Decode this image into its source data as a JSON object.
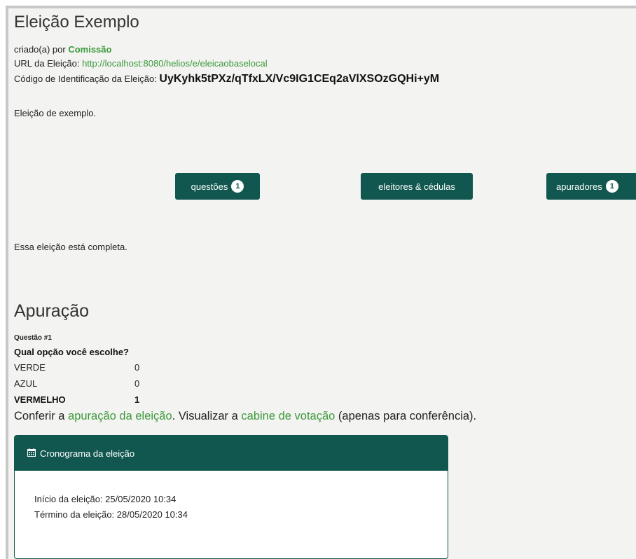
{
  "election": {
    "title": "Eleição Exemplo",
    "created_by_prefix": "criado(a) por ",
    "creator": "Comissão",
    "url_label": "URL da Eleição: ",
    "url": "http://localhost:8080/helios/e/eleicaobaselocal",
    "code_label": "Código de Identificação da Eleição: ",
    "code": "UyKyhk5tPXz/qTfxLX/Vc9IG1CEq2aVlXSOzGQHi+yM",
    "description": "Eleição de exemplo."
  },
  "nav": {
    "questions": {
      "label": "questões",
      "count": "1"
    },
    "voters": {
      "label": "eleitores & cédulas"
    },
    "trustees": {
      "label": "apuradores",
      "count": "1"
    }
  },
  "status": "Essa eleição está completa.",
  "results": {
    "heading": "Apuração",
    "question_number": "Questão #1",
    "question_text": "Qual opção você escolhe?",
    "answers": [
      {
        "label": "VERDE",
        "count": "0"
      },
      {
        "label": "AZUL",
        "count": "0"
      },
      {
        "label": "VERMELHO",
        "count": "1"
      }
    ]
  },
  "verify": {
    "text1": "Conferir a ",
    "link1": "apuração da eleição",
    "text2": ". Visualizar a ",
    "link2": "cabine de votação",
    "text3": " (apenas para conferência)."
  },
  "schedule": {
    "header_icon": "calendar-icon",
    "header": "Cronograma da eleição",
    "start": "Início da eleição: 25/05/2020 10:34",
    "end": "Término da eleição: 28/05/2020 10:34"
  },
  "colors": {
    "primary": "#11574f",
    "link": "#3c9a3c",
    "background": "#f3f3f1"
  }
}
